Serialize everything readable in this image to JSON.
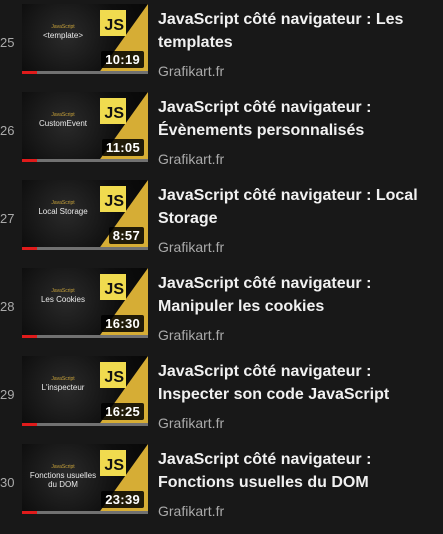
{
  "colors": {
    "background": "#181818",
    "js_badge": "#f0db4f",
    "thumbnail_accent": "#d6ad35",
    "progress": "#e01b1b",
    "progress_track": "#717171"
  },
  "items": [
    {
      "index": "25",
      "thumb_series": "JavaScript",
      "thumb_caption": "<template>",
      "badge": "JS",
      "duration": "10:19",
      "title": "JavaScript côté navigateur : Les templates",
      "channel": "Grafikart.fr",
      "watched_fraction": 0.12
    },
    {
      "index": "26",
      "thumb_series": "JavaScript",
      "thumb_caption": "CustomEvent",
      "badge": "JS",
      "duration": "11:05",
      "title": "JavaScript côté navigateur : Évènements personnalisés",
      "channel": "Grafikart.fr",
      "watched_fraction": 0.12
    },
    {
      "index": "27",
      "thumb_series": "JavaScript",
      "thumb_caption": "Local Storage",
      "badge": "JS",
      "duration": "8:57",
      "title": "JavaScript côté navigateur : Local Storage",
      "channel": "Grafikart.fr",
      "watched_fraction": 0.12
    },
    {
      "index": "28",
      "thumb_series": "JavaScript",
      "thumb_caption": "Les Cookies",
      "badge": "JS",
      "duration": "16:30",
      "title": "JavaScript côté navigateur : Manipuler les cookies",
      "channel": "Grafikart.fr",
      "watched_fraction": 0.12
    },
    {
      "index": "29",
      "thumb_series": "JavaScript",
      "thumb_caption": "L'inspecteur",
      "badge": "JS",
      "duration": "16:25",
      "title": "JavaScript côté navigateur : Inspecter son code JavaScript",
      "channel": "Grafikart.fr",
      "watched_fraction": 0.12
    },
    {
      "index": "30",
      "thumb_series": "JavaScript",
      "thumb_caption": "Fonctions usuelles du DOM",
      "badge": "JS",
      "duration": "23:39",
      "title": "JavaScript côté navigateur : Fonctions usuelles du DOM",
      "channel": "Grafikart.fr",
      "watched_fraction": 0.12
    }
  ]
}
